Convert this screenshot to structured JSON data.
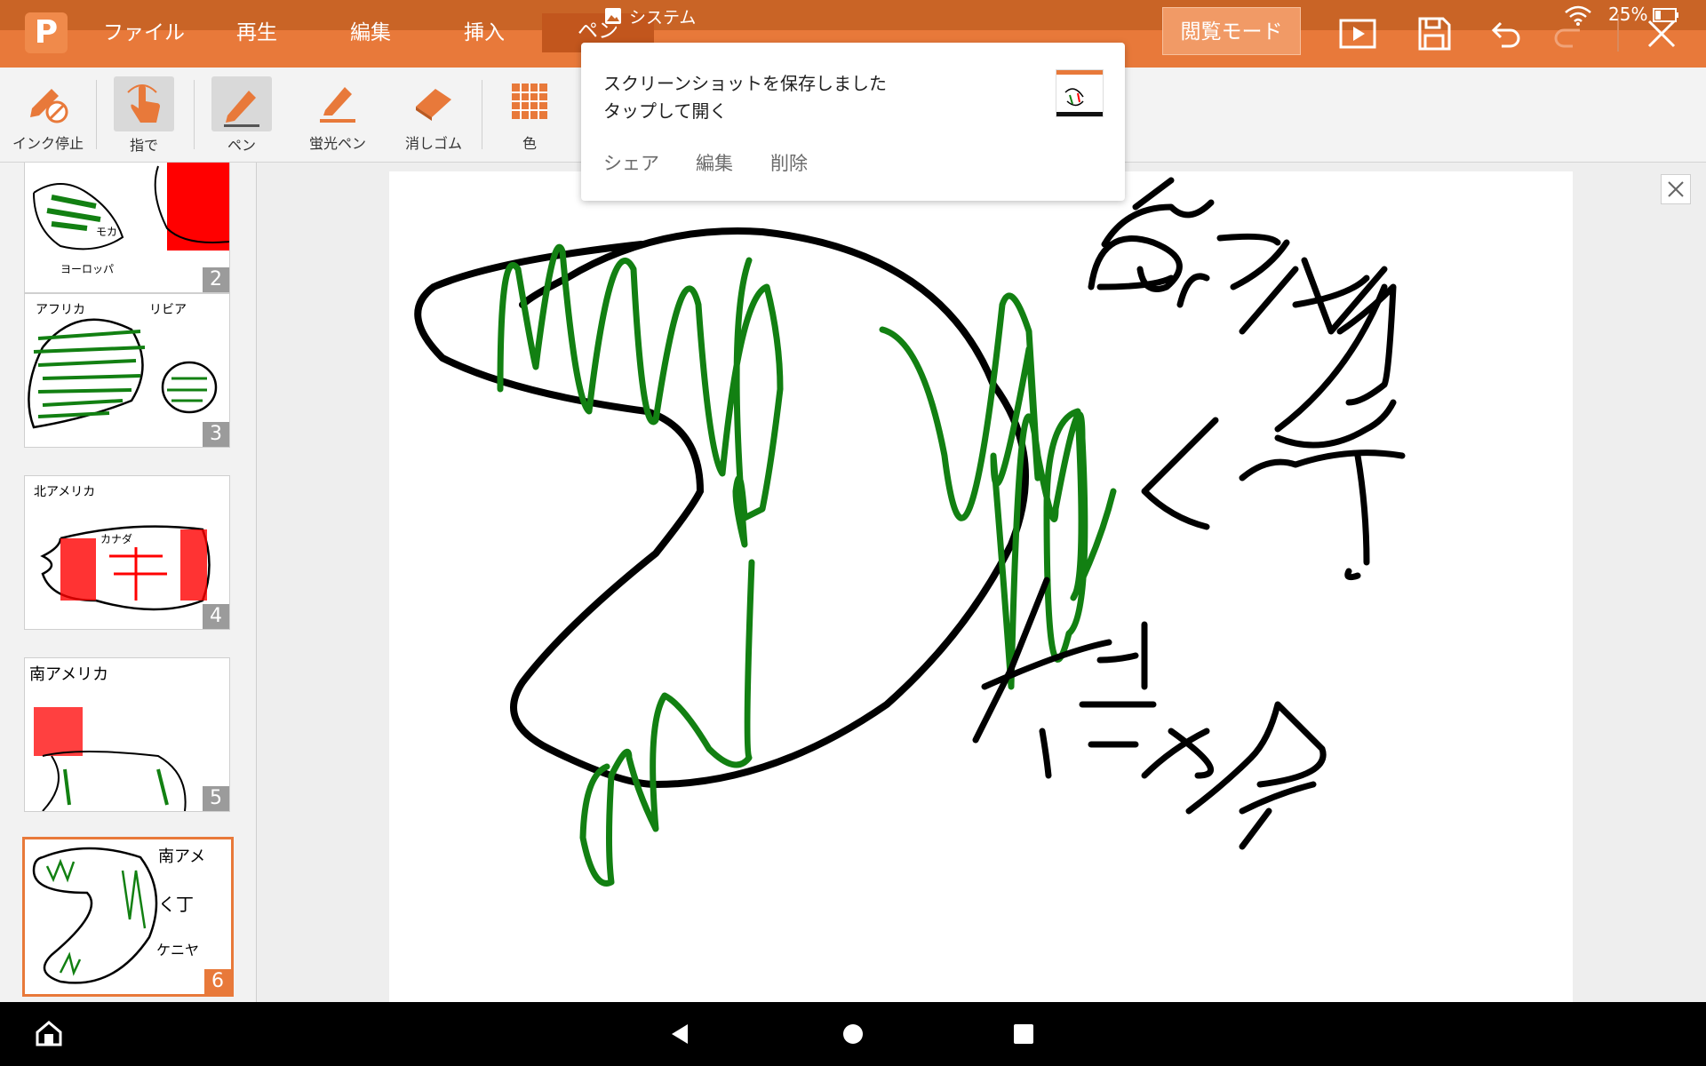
{
  "menu": {
    "items": [
      "ファイル",
      "再生",
      "編集",
      "挿入",
      "ペン"
    ],
    "read_mode": "閲覧モード"
  },
  "status": {
    "battery": "25%"
  },
  "ribbon": {
    "tools": [
      {
        "label": "インク停止",
        "icon": "ink-stop-icon"
      },
      {
        "label": "指で",
        "icon": "finger-icon"
      },
      {
        "label": "ペン",
        "icon": "pen-icon"
      },
      {
        "label": "蛍光ペン",
        "icon": "highlighter-icon"
      },
      {
        "label": "消しゴム",
        "icon": "eraser-icon"
      },
      {
        "label": "色",
        "icon": "color-grid-icon"
      }
    ]
  },
  "thumbnails": [
    "2",
    "3",
    "4",
    "5",
    "6"
  ],
  "notification": {
    "app": "システム",
    "title": "スクリーンショットを保存しました",
    "subtitle": "タップして開く",
    "actions": [
      "シェア",
      "編集",
      "削除"
    ]
  },
  "colors": {
    "accent": "#e8793a",
    "ink_black": "#000000",
    "ink_green": "#128012",
    "ink_red": "#ff0000"
  }
}
